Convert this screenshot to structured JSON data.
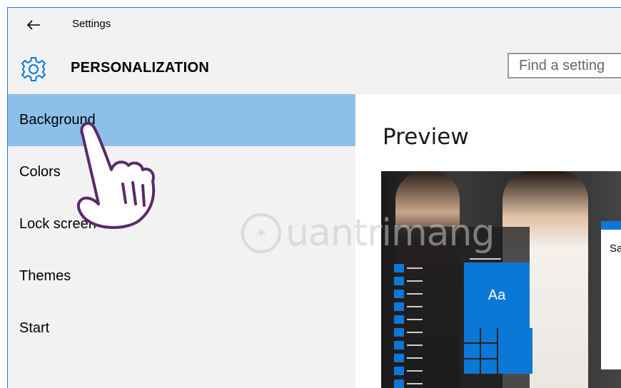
{
  "titlebar": {
    "back_icon": "back-arrow-icon",
    "title": "Settings"
  },
  "header": {
    "icon": "gear-icon",
    "title": "PERSONALIZATION",
    "search_placeholder": "Find a setting"
  },
  "sidebar": {
    "items": [
      {
        "label": "Background",
        "active": true
      },
      {
        "label": "Colors",
        "active": false
      },
      {
        "label": "Lock screen",
        "active": false
      },
      {
        "label": "Themes",
        "active": false
      },
      {
        "label": "Start",
        "active": false
      }
    ]
  },
  "main": {
    "title": "Preview",
    "preview": {
      "tile_label": "Aa",
      "dialog_text": "Sa"
    }
  },
  "watermark": {
    "text": "uantrimang"
  },
  "colors": {
    "accent": "#0c78d6",
    "selected_item": "#8dc0e8",
    "window_border": "#2b79d0",
    "background": "#f2f2f2"
  }
}
